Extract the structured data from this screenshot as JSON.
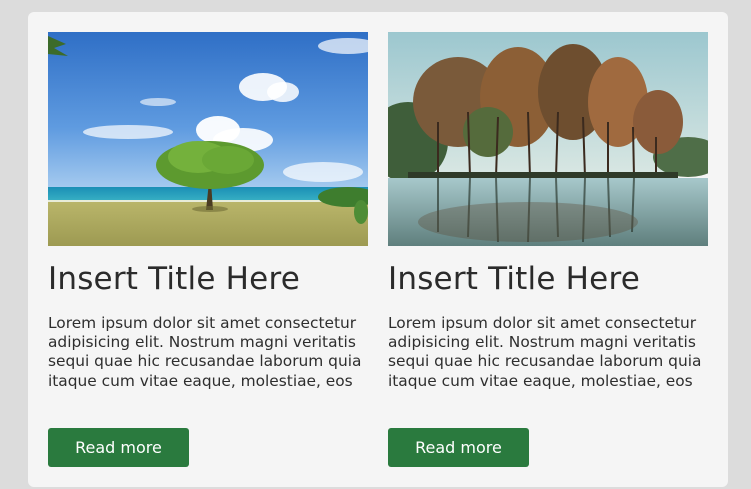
{
  "cards": [
    {
      "image_name": "beach-tree-image",
      "title": "Insert Title Here",
      "body": "Lorem ipsum dolor sit amet consectetur adipisicing elit. Nostrum magni veritatis sequi quae hic recusandae laborum quia itaque cum vitae eaque, molestiae, eos",
      "button_label": "Read more"
    },
    {
      "image_name": "lake-trees-image",
      "title": "Insert Title Here",
      "body": "Lorem ipsum dolor sit amet consectetur adipisicing elit. Nostrum magni veritatis sequi quae hic recusandae laborum quia itaque cum vitae eaque, molestiae, eos",
      "button_label": "Read more"
    }
  ],
  "colors": {
    "page_background": "#dcdcdc",
    "panel_background": "#f5f5f5",
    "button_background": "#2a7a3e",
    "button_text": "#ffffff",
    "title_text": "#2b2b2b"
  }
}
